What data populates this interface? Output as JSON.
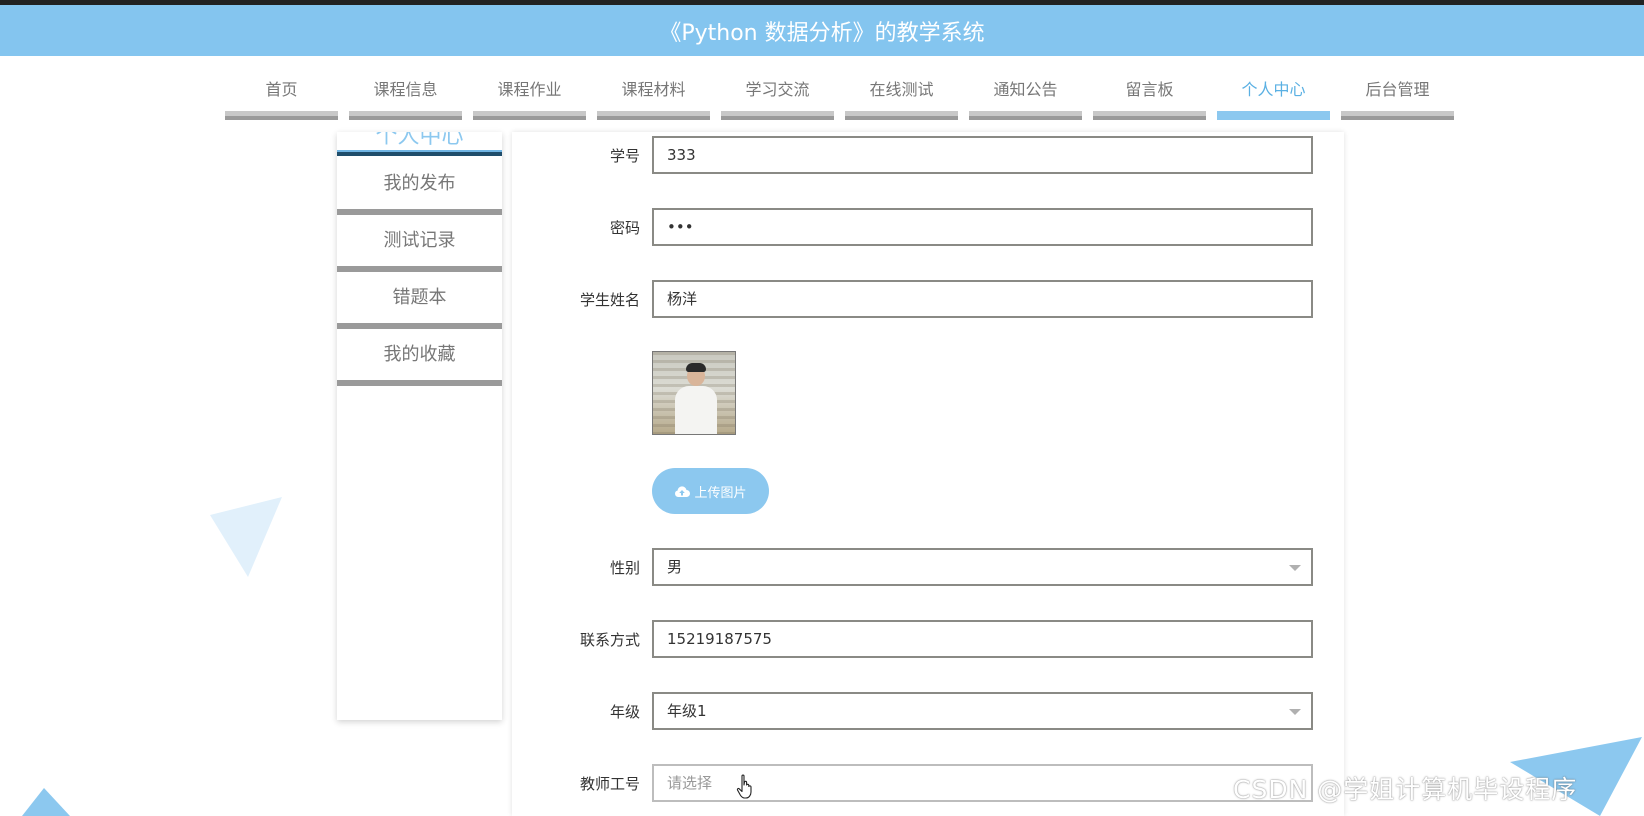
{
  "app": {
    "title": "《Python 数据分析》的教学系统"
  },
  "nav": {
    "items": [
      {
        "label": "首页"
      },
      {
        "label": "课程信息"
      },
      {
        "label": "课程作业"
      },
      {
        "label": "课程材料"
      },
      {
        "label": "学习交流"
      },
      {
        "label": "在线测试"
      },
      {
        "label": "通知公告"
      },
      {
        "label": "留言板"
      },
      {
        "label": "个人中心"
      },
      {
        "label": "后台管理"
      }
    ],
    "active": "个人中心"
  },
  "sidebar": {
    "header": "个人中心",
    "items": [
      {
        "label": "我的发布"
      },
      {
        "label": "测试记录"
      },
      {
        "label": "错题本"
      },
      {
        "label": "我的收藏"
      }
    ]
  },
  "form": {
    "student_id": {
      "label": "学号",
      "value": "333"
    },
    "password": {
      "label": "密码",
      "value": "•••"
    },
    "student_name": {
      "label": "学生姓名",
      "value": "杨洋"
    },
    "upload_label": "上传图片",
    "gender": {
      "label": "性别",
      "value": "男"
    },
    "contact": {
      "label": "联系方式",
      "value": "15219187575"
    },
    "grade": {
      "label": "年级",
      "value": "年级1"
    },
    "teacher_id": {
      "label": "教师工号",
      "placeholder": "请选择"
    }
  },
  "colors": {
    "accent": "#84c5ef",
    "nav_active": "#5ab0e3",
    "bar_gray": "#9a9a9a"
  },
  "watermark": "CSDN @学姐计算机毕设程序"
}
